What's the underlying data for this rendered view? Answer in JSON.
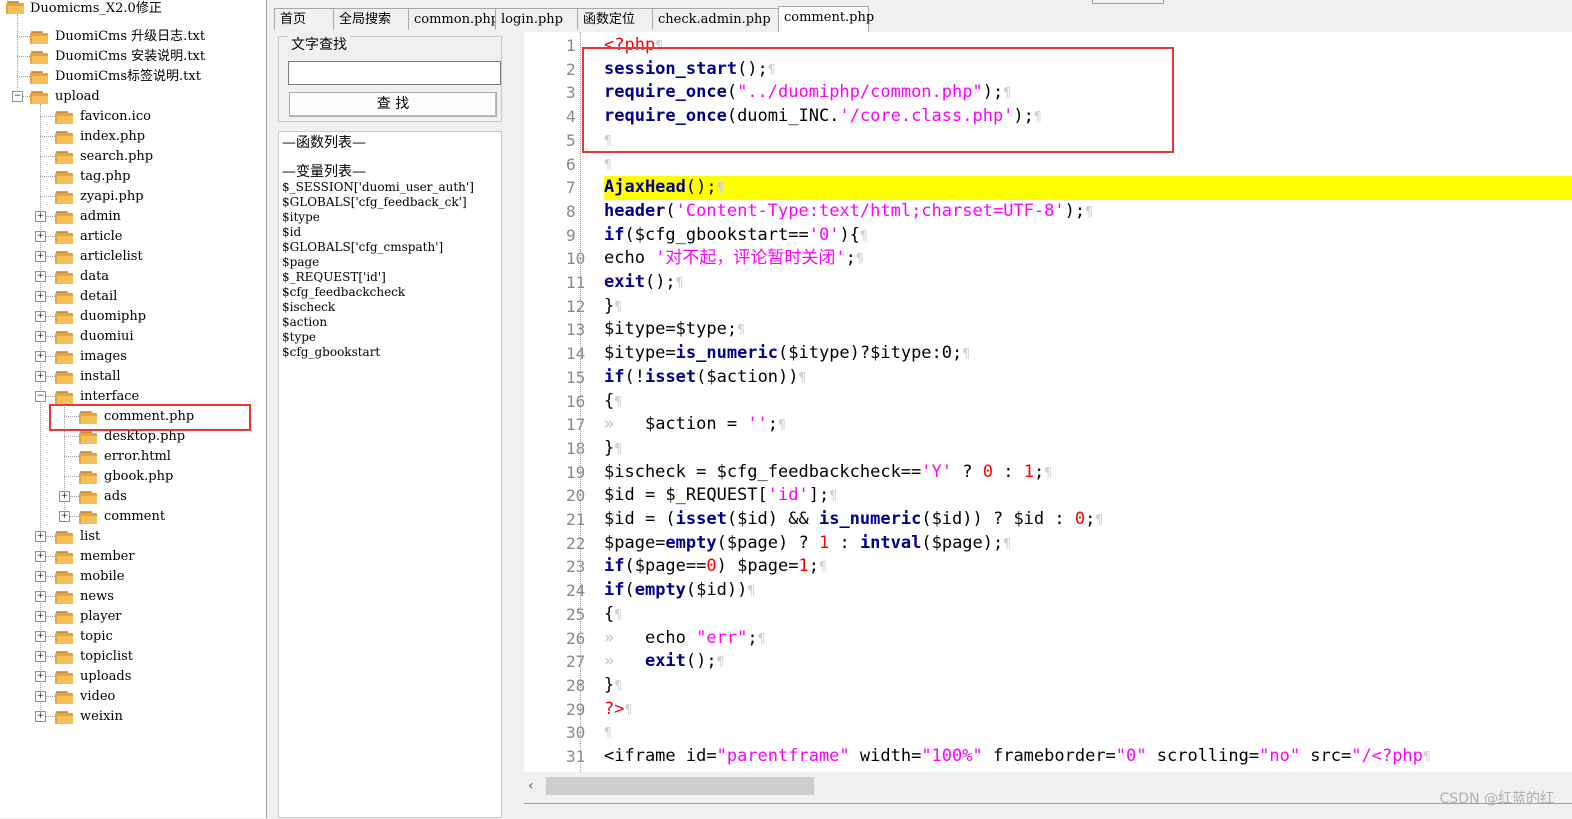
{
  "tree": {
    "root": "Duomicms_X2.0修正",
    "items": [
      {
        "label": "DuomiCms 升级日志.txt",
        "level": 1,
        "expander": ""
      },
      {
        "label": "DuomiCms 安装说明.txt",
        "level": 1,
        "expander": ""
      },
      {
        "label": "DuomiCms标签说明.txt",
        "level": 1,
        "expander": ""
      },
      {
        "label": "upload",
        "level": 1,
        "expander": "−"
      },
      {
        "label": "favicon.ico",
        "level": 2,
        "expander": ""
      },
      {
        "label": "index.php",
        "level": 2,
        "expander": ""
      },
      {
        "label": "search.php",
        "level": 2,
        "expander": ""
      },
      {
        "label": "tag.php",
        "level": 2,
        "expander": ""
      },
      {
        "label": "zyapi.php",
        "level": 2,
        "expander": ""
      },
      {
        "label": "admin",
        "level": 2,
        "expander": "+"
      },
      {
        "label": "article",
        "level": 2,
        "expander": "+"
      },
      {
        "label": "articlelist",
        "level": 2,
        "expander": "+"
      },
      {
        "label": "data",
        "level": 2,
        "expander": "+"
      },
      {
        "label": "detail",
        "level": 2,
        "expander": "+"
      },
      {
        "label": "duomiphp",
        "level": 2,
        "expander": "+"
      },
      {
        "label": "duomiui",
        "level": 2,
        "expander": "+"
      },
      {
        "label": "images",
        "level": 2,
        "expander": "+"
      },
      {
        "label": "install",
        "level": 2,
        "expander": "+"
      },
      {
        "label": "interface",
        "level": 2,
        "expander": "−"
      },
      {
        "label": "comment.php",
        "level": 3,
        "expander": ""
      },
      {
        "label": "desktop.php",
        "level": 3,
        "expander": ""
      },
      {
        "label": "error.html",
        "level": 3,
        "expander": ""
      },
      {
        "label": "gbook.php",
        "level": 3,
        "expander": ""
      },
      {
        "label": "ads",
        "level": 3,
        "expander": "+"
      },
      {
        "label": "comment",
        "level": 3,
        "expander": "+"
      },
      {
        "label": "list",
        "level": 2,
        "expander": "+"
      },
      {
        "label": "member",
        "level": 2,
        "expander": "+"
      },
      {
        "label": "mobile",
        "level": 2,
        "expander": "+"
      },
      {
        "label": "news",
        "level": 2,
        "expander": "+"
      },
      {
        "label": "player",
        "level": 2,
        "expander": "+"
      },
      {
        "label": "topic",
        "level": 2,
        "expander": "+"
      },
      {
        "label": "topiclist",
        "level": 2,
        "expander": "+"
      },
      {
        "label": "uploads",
        "level": 2,
        "expander": "+"
      },
      {
        "label": "video",
        "level": 2,
        "expander": "+"
      },
      {
        "label": "weixin",
        "level": 2,
        "expander": "+"
      }
    ]
  },
  "tabs": [
    {
      "label": "首页",
      "active": false
    },
    {
      "label": "全局搜索",
      "active": false
    },
    {
      "label": "common.php",
      "active": false
    },
    {
      "label": "login.php",
      "active": false
    },
    {
      "label": "函数定位",
      "active": false
    },
    {
      "label": "check.admin.php",
      "active": false
    },
    {
      "label": "comment.php",
      "active": true
    }
  ],
  "search": {
    "group_title": "文字查找",
    "input_value": "",
    "button_label": "查 找"
  },
  "function_list": {
    "func_header": "—函数列表—",
    "var_header": "—变量列表—",
    "variables": [
      "$_SESSION['duomi_user_auth']",
      "$GLOBALS['cfg_feedback_ck']",
      "$itype",
      "$id",
      "$GLOBALS['cfg_cmspath']",
      "$page",
      "$_REQUEST['id']",
      "$cfg_feedbackcheck",
      "$ischeck",
      "$action",
      "$type",
      "$cfg_gbookstart"
    ]
  },
  "editor": {
    "highlighted_line": 7,
    "lines": [
      [
        [
          "php",
          "<?php"
        ]
      ],
      [
        [
          "kw",
          "session_start"
        ],
        [
          "var",
          "();"
        ]
      ],
      [
        [
          "kw",
          "require_once"
        ],
        [
          "var",
          "("
        ],
        [
          "str",
          "\"../duomiphp/common.php\""
        ],
        [
          "var",
          ");"
        ]
      ],
      [
        [
          "kw",
          "require_once"
        ],
        [
          "var",
          "(duomi_INC."
        ],
        [
          "str",
          "'/core.class.php'"
        ],
        [
          "var",
          ");"
        ]
      ],
      [],
      [],
      [
        [
          "kw",
          "AjaxHead"
        ],
        [
          "var",
          "();"
        ]
      ],
      [
        [
          "kw",
          "header"
        ],
        [
          "var",
          "("
        ],
        [
          "str",
          "'Content-Type:text/html;charset=UTF-8'"
        ],
        [
          "var",
          ");"
        ]
      ],
      [
        [
          "kw",
          "if"
        ],
        [
          "var",
          "($cfg_gbookstart=="
        ],
        [
          "str",
          "'0'"
        ],
        [
          "var",
          "){"
        ]
      ],
      [
        [
          "var",
          "echo "
        ],
        [
          "str",
          "'对不起，评论暂时关闭'"
        ],
        [
          "var",
          ";"
        ]
      ],
      [
        [
          "kw",
          "exit"
        ],
        [
          "var",
          "();"
        ]
      ],
      [
        [
          "var",
          "}"
        ]
      ],
      [
        [
          "var",
          "$itype=$type;"
        ]
      ],
      [
        [
          "var",
          "$itype="
        ],
        [
          "kw",
          "is_numeric"
        ],
        [
          "var",
          "($itype)?$itype:0;"
        ]
      ],
      [
        [
          "kw",
          "if"
        ],
        [
          "var",
          "(!"
        ],
        [
          "kw",
          "isset"
        ],
        [
          "var",
          "($action))"
        ]
      ],
      [
        [
          "var",
          "{"
        ]
      ],
      [
        [
          "arr",
          "»   "
        ],
        [
          "var",
          "$action = "
        ],
        [
          "str",
          "''"
        ],
        [
          "var",
          ";"
        ]
      ],
      [
        [
          "var",
          "}"
        ]
      ],
      [
        [
          "var",
          "$ischeck = $cfg_feedbackcheck=="
        ],
        [
          "str",
          "'Y'"
        ],
        [
          "var",
          " ? "
        ],
        [
          "num",
          "0"
        ],
        [
          "var",
          " : "
        ],
        [
          "num",
          "1"
        ],
        [
          "var",
          ";"
        ]
      ],
      [
        [
          "var",
          "$id = $_REQUEST["
        ],
        [
          "str",
          "'id'"
        ],
        [
          "var",
          "];"
        ]
      ],
      [
        [
          "var",
          "$id = ("
        ],
        [
          "kw",
          "isset"
        ],
        [
          "var",
          "($id) && "
        ],
        [
          "kw",
          "is_numeric"
        ],
        [
          "var",
          "($id)) ? $id : "
        ],
        [
          "num",
          "0"
        ],
        [
          "var",
          ";"
        ]
      ],
      [
        [
          "var",
          "$page="
        ],
        [
          "kw",
          "empty"
        ],
        [
          "var",
          "($page) ? "
        ],
        [
          "num",
          "1"
        ],
        [
          "var",
          " : "
        ],
        [
          "kw",
          "intval"
        ],
        [
          "var",
          "($page);"
        ]
      ],
      [
        [
          "kw",
          "if"
        ],
        [
          "var",
          "($page=="
        ],
        [
          "num",
          "0"
        ],
        [
          "var",
          ") $page="
        ],
        [
          "num",
          "1"
        ],
        [
          "var",
          ";"
        ]
      ],
      [
        [
          "kw",
          "if"
        ],
        [
          "var",
          "("
        ],
        [
          "kw",
          "empty"
        ],
        [
          "var",
          "($id))"
        ]
      ],
      [
        [
          "var",
          "{"
        ]
      ],
      [
        [
          "arr",
          "»   "
        ],
        [
          "var",
          "echo "
        ],
        [
          "str",
          "\"err\""
        ],
        [
          "var",
          ";"
        ]
      ],
      [
        [
          "arr",
          "»   "
        ],
        [
          "kw",
          "exit"
        ],
        [
          "var",
          "();"
        ]
      ],
      [
        [
          "var",
          "}"
        ]
      ],
      [
        [
          "php",
          "?>"
        ]
      ],
      [],
      [
        [
          "var",
          "<iframe id="
        ],
        [
          "str",
          "\"parentframe\""
        ],
        [
          "var",
          " width="
        ],
        [
          "str",
          "\"100%\""
        ],
        [
          "var",
          " frameborder="
        ],
        [
          "str",
          "\"0\""
        ],
        [
          "var",
          " scrolling="
        ],
        [
          "str",
          "\"no\""
        ],
        [
          "var",
          " src="
        ],
        [
          "str",
          "\"/<?php"
        ]
      ]
    ]
  },
  "watermark": "CSDN @红蓝的红",
  "colors": {
    "highlight": "#ffff00",
    "annotation": "#e53935",
    "keyword": "#00008b",
    "string": "#ff00ff"
  }
}
